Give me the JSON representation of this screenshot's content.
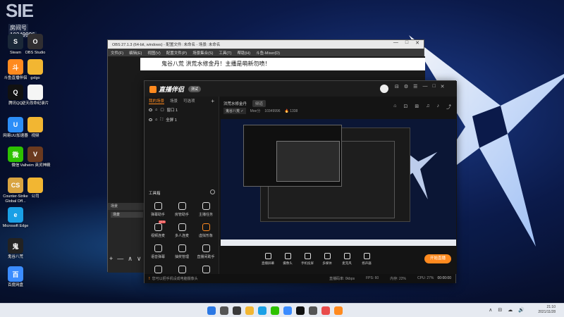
{
  "desktop": {
    "room_badge": {
      "big": "SIE",
      "label": "房间号",
      "number": "10349996"
    },
    "icons": [
      {
        "label": "Steam",
        "color": "#1b2838",
        "glyph": "S"
      },
      {
        "label": "OBS Studio",
        "color": "#302e31",
        "glyph": "O"
      },
      {
        "label": "斗鱼直播伴侣",
        "color": "#ff8a1f",
        "glyph": "斗"
      },
      {
        "label": "gxlgo",
        "color": "#f2b632",
        "glyph": ""
      },
      {
        "label": "腾讯QQ",
        "color": "#111111",
        "glyph": "Q"
      },
      {
        "label": "逆天改命纪录片",
        "color": "#f5f5f5",
        "glyph": ""
      },
      {
        "label": "网易UU加速器",
        "color": "#2c8ef8",
        "glyph": "U"
      },
      {
        "label": "视频",
        "color": "#f2b632",
        "glyph": ""
      },
      {
        "label": "微信",
        "color": "#2dc100",
        "glyph": "微"
      },
      {
        "label": "Valheim 英灵神殿",
        "color": "#6b3a1f",
        "glyph": "V"
      },
      {
        "label": "Counter-Strike Global Off...",
        "color": "#d9a441",
        "glyph": "CS"
      },
      {
        "label": "公司",
        "color": "#f2b632",
        "glyph": ""
      },
      {
        "label": "Microsoft Edge",
        "color": "#1aa0e6",
        "glyph": "e"
      },
      {
        "label": "鬼谷八荒",
        "color": "#222222",
        "glyph": "鬼"
      },
      {
        "label": "百度网盘",
        "color": "#3b8cff",
        "glyph": "百"
      }
    ]
  },
  "obs": {
    "title": "OBS 27.1.3 (64-bit, windows) - 配置文件: 未命名 - 场景: 未命名",
    "controls": [
      "—",
      "□",
      "✕"
    ],
    "menu": [
      "文件(F)",
      "编辑(E)",
      "视图(V)",
      "配置文件(P)",
      "场景集合(S)",
      "工具(T)",
      "帮助(H)",
      "斗鱼-Mixer(D)"
    ],
    "banner_text": "鬼谷八荒  洪荒水修金丹！主播是萌新勿喷！",
    "dock_scenes": "场景",
    "dock_sources": "来源",
    "scene_item": "场景",
    "toolbar": [
      "+",
      "—",
      "∧",
      "∨"
    ]
  },
  "assistant": {
    "logo": "直播伴侣",
    "beta": "测试",
    "window_controls": [
      "⊟",
      "⚙",
      "☰",
      "—",
      "□",
      "✕"
    ],
    "tabs": [
      "我的场景",
      "场景",
      "可选项"
    ],
    "add": "+",
    "sources": [
      "窗口 1",
      "全屏 1"
    ],
    "toolbox_title": "工具箱",
    "tools": [
      {
        "label": "弹幕助手",
        "orange": false,
        "new": false
      },
      {
        "label": "房管助手",
        "orange": false,
        "new": false
      },
      {
        "label": "主播任务",
        "orange": false,
        "new": false
      },
      {
        "label": "视频连麦",
        "orange": false,
        "new": true
      },
      {
        "label": "多人连麦",
        "orange": false,
        "new": false
      },
      {
        "label": "虚拟形象",
        "orange": true,
        "new": false
      },
      {
        "label": "语音弹幕",
        "orange": false,
        "new": false
      },
      {
        "label": "抽奖管理",
        "orange": false,
        "new": false
      },
      {
        "label": "直播间助手",
        "orange": false,
        "new": false
      },
      {
        "label": "房间管理",
        "orange": false,
        "new": false
      },
      {
        "label": "福利助手",
        "orange": false,
        "new": false
      },
      {
        "label": "更多",
        "orange": false,
        "new": false
      }
    ],
    "room_tabs": [
      "洪荒水修金丹",
      "频道"
    ],
    "room_info": {
      "category": "鬼谷八荒 ✓",
      "anchor": "Moe分",
      "room_no": "10349996",
      "hot": "🔥 1338"
    },
    "right_icons": [
      "⌂",
      "⊡",
      "⊞",
      "♫",
      "♪",
      "⤴"
    ],
    "bottom_items": [
      "直播屏幕",
      "摄像头",
      "手机投屏",
      "多媒体",
      "麦克风",
      "扬声器"
    ],
    "start_button": "开始直播",
    "status": {
      "warning": "!",
      "message": "您可以把手机设成电脑摄像头",
      "stats": [
        "直播码率: 0kbps",
        "FPS: 60",
        "内存: 22%",
        "CPU: 27%"
      ],
      "timer": "00:00:00"
    }
  },
  "taskbar": {
    "app_colors": [
      "#2b78e4",
      "#555555",
      "#3a3a3a",
      "#f2b632",
      "#1aa0e6",
      "#2dc100",
      "#3b8cff",
      "#111111",
      "#555555",
      "#e94c4c",
      "#ff8a1f"
    ],
    "tray": [
      "∧",
      "⊟",
      "☁",
      "🔊"
    ],
    "time": "21:10",
    "date": "2021/11/28"
  }
}
